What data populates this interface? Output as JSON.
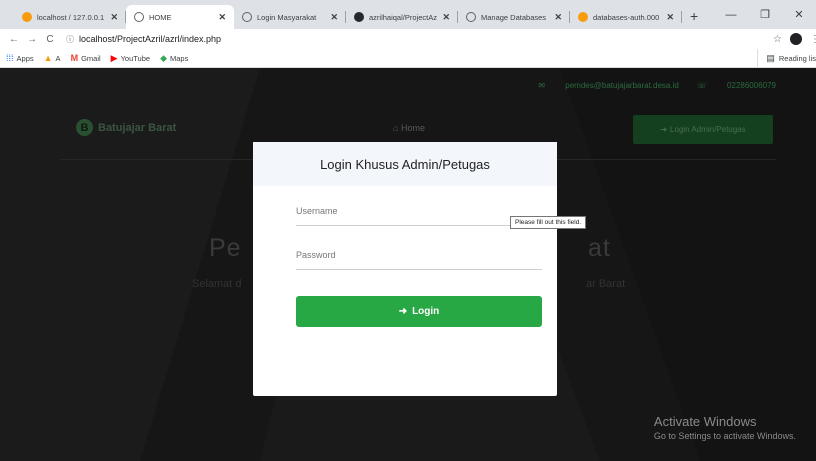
{
  "browser": {
    "tabs": [
      {
        "title": "localhost / 127.0.0.1",
        "icon": "phpmyadmin-icon",
        "color": "#f89c0e"
      },
      {
        "title": "HOME",
        "icon": "globe-icon",
        "color": "#5f6368"
      },
      {
        "title": "Login Masyarakat",
        "icon": "globe-icon",
        "color": "#5f6368"
      },
      {
        "title": "azrilhaiqal/ProjectAz",
        "icon": "github-icon",
        "color": "#24292e"
      },
      {
        "title": "Manage Databases",
        "icon": "globe-icon",
        "color": "#5f6368"
      },
      {
        "title": "databases-auth.000",
        "icon": "phpmyadmin-icon",
        "color": "#f89c0e"
      }
    ],
    "new_tab_label": "+",
    "url": "localhost/ProjectAzril/azrl/index.php",
    "bookmarks": [
      {
        "label": "Apps",
        "icon": "apps-grid-icon",
        "color": "#1a73e8"
      },
      {
        "label": "A",
        "icon": "phpmyadmin-icon",
        "color": "#f89c0e"
      },
      {
        "label": "Gmail",
        "icon": "gmail-icon",
        "color": "#ea4335"
      },
      {
        "label": "YouTube",
        "icon": "youtube-icon",
        "color": "#ff0000"
      },
      {
        "label": "Maps",
        "icon": "maps-icon",
        "color": "#34a853"
      }
    ],
    "reading_list": "Reading lis"
  },
  "site": {
    "email": "pemdes@batujajarbarat.desa.id",
    "phone": "02286006079",
    "brand": "Batujajar Barat",
    "brand_letter": "B",
    "nav_home": "Home",
    "login_admin_button": "Login Admin/Petugas",
    "hero_title_left": "Pe",
    "hero_title_right": "at",
    "hero_sub_left": "Selamat d",
    "hero_sub_right": "ar Barat"
  },
  "modal": {
    "title": "Login Khusus Admin/Petugas",
    "username_placeholder": "Username",
    "password_placeholder": "Password",
    "login_button": "Login",
    "validation_tooltip": "Please fill out this field."
  },
  "windows_watermark": {
    "line1": "Activate Windows",
    "line2": "Go to Settings to activate Windows."
  }
}
